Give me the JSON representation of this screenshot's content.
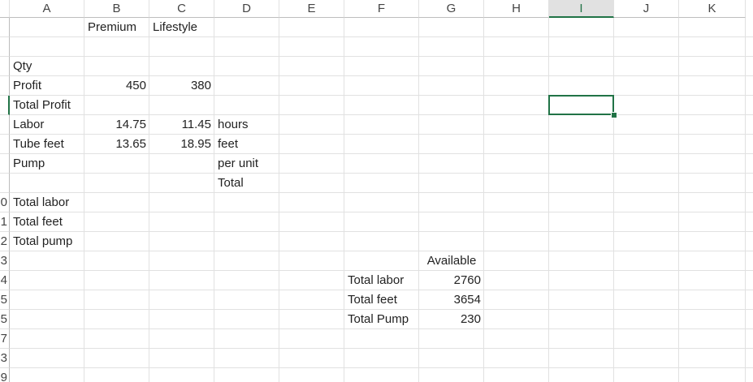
{
  "columns": [
    "A",
    "B",
    "C",
    "D",
    "E",
    "F",
    "G",
    "H",
    "I",
    "J",
    "K"
  ],
  "rows": [
    "",
    "",
    "",
    "",
    "",
    "",
    "",
    "",
    "",
    "0",
    "1",
    "2",
    "3",
    "4",
    "5",
    "5",
    "7",
    "3",
    "9"
  ],
  "selected": {
    "column": "I",
    "row_index": 5
  },
  "cells": {
    "B1": "Premium",
    "C1": "Lifestyle",
    "A3": "Qty",
    "A4": "Profit",
    "B4": "450",
    "C4": "380",
    "A5": "Total Profit",
    "A6": "Labor",
    "B6": "14.75",
    "C6": "11.45",
    "D6": "hours",
    "A7": "Tube feet",
    "B7": "13.65",
    "C7": "18.95",
    "D7": "feet",
    "A8": "Pump",
    "D8": "per unit",
    "D9": "Total",
    "A10": "Total labor",
    "A11": "Total feet",
    "A12": "Total pump",
    "G13": "Available",
    "F14": "Total labor",
    "G14": "2760",
    "F15": "Total feet",
    "G15": "3654",
    "F16": "Total Pump",
    "G16": "230"
  },
  "colors": {
    "accent": "#217346",
    "grid": "#e1e1e1"
  }
}
